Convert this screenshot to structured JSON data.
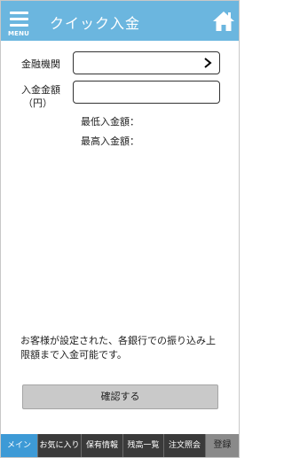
{
  "header": {
    "menu_label": "MENU",
    "title": "クイック入金",
    "background": "#6bb6df"
  },
  "form": {
    "bank_label": "金融機関",
    "amount_label_line1": "入金金額",
    "amount_label_line2": "（円）",
    "amount_value": "",
    "min_label": "最低入金額：",
    "max_label": "最高入金額："
  },
  "note": "お客様が設定された、各銀行での振り込み上限額まで入金可能です。",
  "confirm_label": "確認する",
  "tabs": [
    {
      "label": "メイン",
      "active": true
    },
    {
      "label": "お気に入り",
      "active": false
    },
    {
      "label": "保有情報",
      "active": false
    },
    {
      "label": "残高一覧",
      "active": false
    },
    {
      "label": "注文照会",
      "active": false
    },
    {
      "label": "登録",
      "active": false
    }
  ],
  "icons": {
    "menu": "menu-icon",
    "home": "home-icon",
    "chevron": "chevron-right-icon"
  },
  "colors": {
    "accent": "#6bb6df",
    "tab_active": "#3d9ad6",
    "tab_bg": "#3a3a3a",
    "button_bg": "#c9c9c9"
  }
}
